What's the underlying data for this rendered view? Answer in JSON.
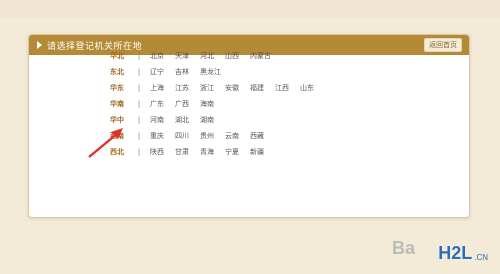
{
  "panel": {
    "title": "请选择登记机关所在地",
    "back_label": "返回首页"
  },
  "regions": [
    {
      "name": "华北",
      "provinces": [
        "北京",
        "天津",
        "河北",
        "山西",
        "内蒙古"
      ]
    },
    {
      "name": "东北",
      "provinces": [
        "辽宁",
        "吉林",
        "黑龙江"
      ]
    },
    {
      "name": "华东",
      "provinces": [
        "上海",
        "江苏",
        "浙江",
        "安徽",
        "福建",
        "江西",
        "山东"
      ]
    },
    {
      "name": "华南",
      "provinces": [
        "广东",
        "广西",
        "海南"
      ]
    },
    {
      "name": "华中",
      "provinces": [
        "河南",
        "湖北",
        "湖南"
      ]
    },
    {
      "name": "西南",
      "provinces": [
        "重庆",
        "四川",
        "贵州",
        "云南",
        "西藏"
      ]
    },
    {
      "name": "西北",
      "provinces": [
        "陕西",
        "甘肃",
        "青海",
        "宁夏",
        "新疆"
      ]
    }
  ],
  "separator": "|",
  "watermark": "Ba",
  "logo": {
    "main": "H2L",
    "sub": ".CN"
  },
  "colors": {
    "header": "#b48a36",
    "region": "#a06a1e",
    "arrow": "#e0302a"
  }
}
